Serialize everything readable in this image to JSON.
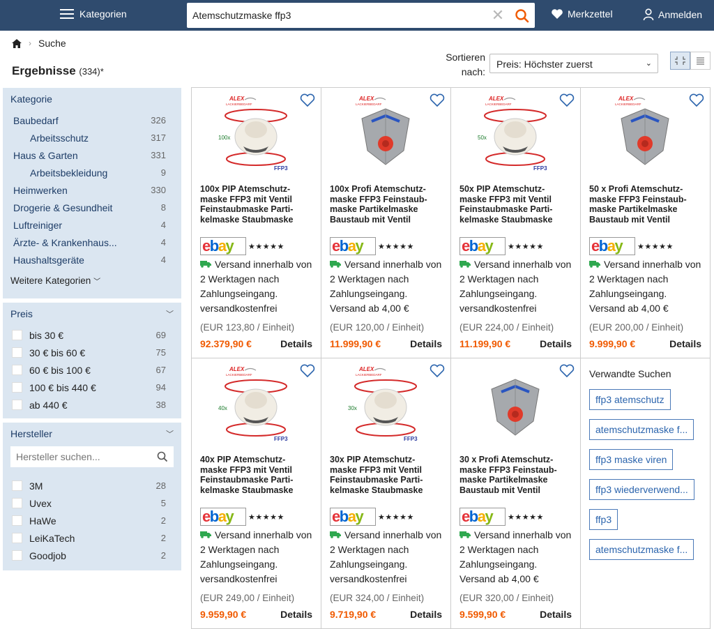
{
  "header": {
    "categories_label": "Kategorien",
    "search_value": "Atemschutzmaske ffp3",
    "wishlist_label": "Merkzettel",
    "login_label": "Anmelden"
  },
  "breadcrumb": {
    "current": "Suche"
  },
  "results": {
    "title": "Ergebnisse",
    "count": "(334)*"
  },
  "sort": {
    "label_line1": "Sortieren",
    "label_line2": "nach:",
    "selected": "Preis: Höchster zuerst"
  },
  "sidebar": {
    "category_title": "Kategorie",
    "categories": [
      {
        "label": "Baubedarf",
        "count": "326",
        "sub": false
      },
      {
        "label": "Arbeitsschutz",
        "count": "317",
        "sub": true
      },
      {
        "label": "Haus & Garten",
        "count": "331",
        "sub": false
      },
      {
        "label": "Arbeitsbekleidung",
        "count": "9",
        "sub": true
      },
      {
        "label": "Heimwerken",
        "count": "330",
        "sub": false
      },
      {
        "label": "Drogerie & Gesundheit",
        "count": "8",
        "sub": false
      },
      {
        "label": "Luftreiniger",
        "count": "4",
        "sub": false
      },
      {
        "label": "Ärzte- & Krankenhaus...",
        "count": "4",
        "sub": false
      },
      {
        "label": "Haushaltsgeräte",
        "count": "4",
        "sub": false
      }
    ],
    "more_categories": "Weitere Kategorien",
    "price_title": "Preis",
    "prices": [
      {
        "label": "bis 30 €",
        "count": "69"
      },
      {
        "label": "30 € bis 60 €",
        "count": "75"
      },
      {
        "label": "60 € bis 100 €",
        "count": "67"
      },
      {
        "label": "100 € bis 440 €",
        "count": "94"
      },
      {
        "label": "ab 440 €",
        "count": "38"
      }
    ],
    "manufacturer_title": "Hersteller",
    "manufacturer_placeholder": "Hersteller suchen...",
    "manufacturers": [
      {
        "label": "3M",
        "count": "28"
      },
      {
        "label": "Uvex",
        "count": "5"
      },
      {
        "label": "HaWe",
        "count": "2"
      },
      {
        "label": "LeiKaTech",
        "count": "2"
      },
      {
        "label": "Goodjob",
        "count": "2"
      }
    ]
  },
  "products": [
    {
      "title": "100x PIP Atemschutz-maske FFP3 mit Ventil Feinstaubmaske Parti-kelmaske Staubmaske",
      "image": "round",
      "qty_label": "100x",
      "ship1": "Versand innerhalb von 2 Werktagen nach Zahlungseingang.",
      "ship2": "versandkostenfrei",
      "unit": "(EUR 123,80 / Einheit)",
      "price": "92.379,90 €"
    },
    {
      "title": "100x Profi Atemschutz-maske FFP3 Feinstaub-maske Partikelmaske Baustaub mit Ventil",
      "image": "fold",
      "qty_label": "",
      "ship1": "Versand innerhalb von 2 Werktagen nach Zahlungseingang.",
      "ship2": "Versand ab 4,00 €",
      "unit": "(EUR 120,00 / Einheit)",
      "price": "11.999,90 €"
    },
    {
      "title": "50x PIP Atemschutz-maske FFP3 mit Ventil Feinstaubmaske Parti-kelmaske Staubmaske",
      "image": "round",
      "qty_label": "50x",
      "ship1": "Versand innerhalb von 2 Werktagen nach Zahlungseingang.",
      "ship2": "versandkostenfrei",
      "unit": "(EUR 224,00 / Einheit)",
      "price": "11.199,90 €"
    },
    {
      "title": "50 x Profi Atemschutz-maske FFP3 Feinstaub-maske Partikelmaske Baustaub mit Ventil",
      "image": "fold",
      "qty_label": "",
      "ship1": "Versand innerhalb von 2 Werktagen nach Zahlungseingang.",
      "ship2": "Versand ab 4,00 €",
      "unit": "(EUR 200,00 / Einheit)",
      "price": "9.999,90 €"
    },
    {
      "title": "40x PIP Atemschutz-maske FFP3 mit Ventil Feinstaubmaske Parti-kelmaske Staubmaske",
      "image": "round",
      "qty_label": "40x",
      "ship1": "Versand innerhalb von 2 Werktagen nach Zahlungseingang.",
      "ship2": "versandkostenfrei",
      "unit": "(EUR 249,00 / Einheit)",
      "price": "9.959,90 €"
    },
    {
      "title": "30x PIP Atemschutz-maske FFP3 mit Ventil Feinstaubmaske Parti-kelmaske Staubmaske",
      "image": "round",
      "qty_label": "30x",
      "ship1": "Versand innerhalb von 2 Werktagen nach Zahlungseingang.",
      "ship2": "versandkostenfrei",
      "unit": "(EUR 324,00 / Einheit)",
      "price": "9.719,90 €"
    },
    {
      "title": "30 x Profi Atemschutz-maske FFP3 Feinstaub-maske Partikelmaske Baustaub mit Ventil",
      "image": "fold-plain",
      "qty_label": "",
      "ship1": "Versand innerhalb von 2 Werktagen nach Zahlungseingang.",
      "ship2": "Versand ab 4,00 €",
      "unit": "(EUR 320,00 / Einheit)",
      "price": "9.599,90 €"
    }
  ],
  "product_common": {
    "details_label": "Details",
    "brand_label": "ALEX",
    "brand_sub": "LACKIERBEDARF",
    "ffp3_label": "FFP3",
    "stars": "★★★★★"
  },
  "related": {
    "title": "Verwandte Suchen",
    "items": [
      "ffp3 atemschutz",
      "atemschutzmaske f...",
      "ffp3 maske viren",
      "ffp3 wiederverwend...",
      "ffp3",
      "atemschutzmaske f..."
    ]
  },
  "colors": {
    "header_bg": "#2f4b6e",
    "sidebar_bg": "#dbe6f1",
    "price": "#f05a00",
    "ship_green": "#2fa84f"
  }
}
